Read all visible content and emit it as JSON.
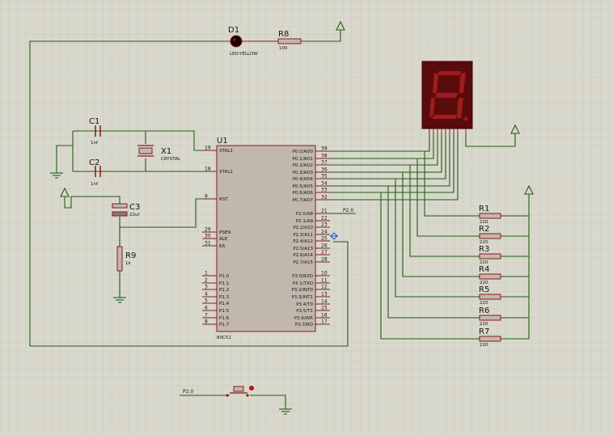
{
  "components": {
    "d1": {
      "ref": "D1",
      "value": "LED-YELLOW"
    },
    "r8": {
      "ref": "R8",
      "value": "100"
    },
    "c1": {
      "ref": "C1",
      "value": "1nf"
    },
    "c2": {
      "ref": "C2",
      "value": "1nf"
    },
    "x1": {
      "ref": "X1",
      "value": "CRYSTAL"
    },
    "c3": {
      "ref": "C3",
      "value": "22uf"
    },
    "r9": {
      "ref": "R9",
      "value": "1k"
    },
    "u1": {
      "ref": "U1",
      "value": "80C51"
    },
    "resistors": [
      {
        "ref": "R1",
        "value": "220"
      },
      {
        "ref": "R2",
        "value": "220"
      },
      {
        "ref": "R3",
        "value": "220"
      },
      {
        "ref": "R4",
        "value": "220"
      },
      {
        "ref": "R5",
        "value": "220"
      },
      {
        "ref": "R6",
        "value": "220"
      },
      {
        "ref": "R7",
        "value": "220"
      }
    ]
  },
  "u1_pins": {
    "left": [
      {
        "num": "19",
        "name": "XTAL1"
      },
      {
        "num": "18",
        "name": "XTAL2"
      },
      {
        "num": "9",
        "name": "RST"
      },
      {
        "num": "29",
        "name": "PSEN"
      },
      {
        "num": "30",
        "name": "ALE"
      },
      {
        "num": "31",
        "name": "EA"
      },
      {
        "num": "1",
        "name": "P1.0"
      },
      {
        "num": "2",
        "name": "P1.1"
      },
      {
        "num": "3",
        "name": "P1.2"
      },
      {
        "num": "4",
        "name": "P1.3"
      },
      {
        "num": "5",
        "name": "P1.4"
      },
      {
        "num": "6",
        "name": "P1.5"
      },
      {
        "num": "7",
        "name": "P1.6"
      },
      {
        "num": "8",
        "name": "P1.7"
      }
    ],
    "right": [
      {
        "num": "39",
        "name": "P0.0/AD0"
      },
      {
        "num": "38",
        "name": "P0.1/AD1"
      },
      {
        "num": "37",
        "name": "P0.2/AD2"
      },
      {
        "num": "36",
        "name": "P0.3/AD3"
      },
      {
        "num": "35",
        "name": "P0.4/AD4"
      },
      {
        "num": "34",
        "name": "P0.5/AD5"
      },
      {
        "num": "33",
        "name": "P0.6/AD6"
      },
      {
        "num": "32",
        "name": "P0.7/AD7"
      },
      {
        "num": "21",
        "name": "P2.0/A8"
      },
      {
        "num": "22",
        "name": "P2.1/A9"
      },
      {
        "num": "23",
        "name": "P2.2/A10"
      },
      {
        "num": "24",
        "name": "P2.3/A11"
      },
      {
        "num": "25",
        "name": "P2.4/A12"
      },
      {
        "num": "26",
        "name": "P2.5/A13"
      },
      {
        "num": "27",
        "name": "P2.6/A14"
      },
      {
        "num": "28",
        "name": "P2.7/A15"
      },
      {
        "num": "10",
        "name": "P3.0/RXD"
      },
      {
        "num": "11",
        "name": "P3.1/TXD"
      },
      {
        "num": "12",
        "name": "P3.2/INT0"
      },
      {
        "num": "13",
        "name": "P3.3/INT1"
      },
      {
        "num": "14",
        "name": "P3.4/T0"
      },
      {
        "num": "15",
        "name": "P3.5/T1"
      },
      {
        "num": "16",
        "name": "P3.6/WR"
      },
      {
        "num": "17",
        "name": "P3.7/RD"
      }
    ]
  },
  "net_labels": {
    "p20_top": "P2.0",
    "p20_bottom": "P2.0"
  },
  "colors": {
    "background": "#d9d8cc",
    "grid": "#c6c5b6",
    "wire": "#1f5d14",
    "body": "#c2b7ad",
    "outline": "#8a1a1a",
    "display": "#5a0b0b",
    "segment": "#a11c1c"
  }
}
